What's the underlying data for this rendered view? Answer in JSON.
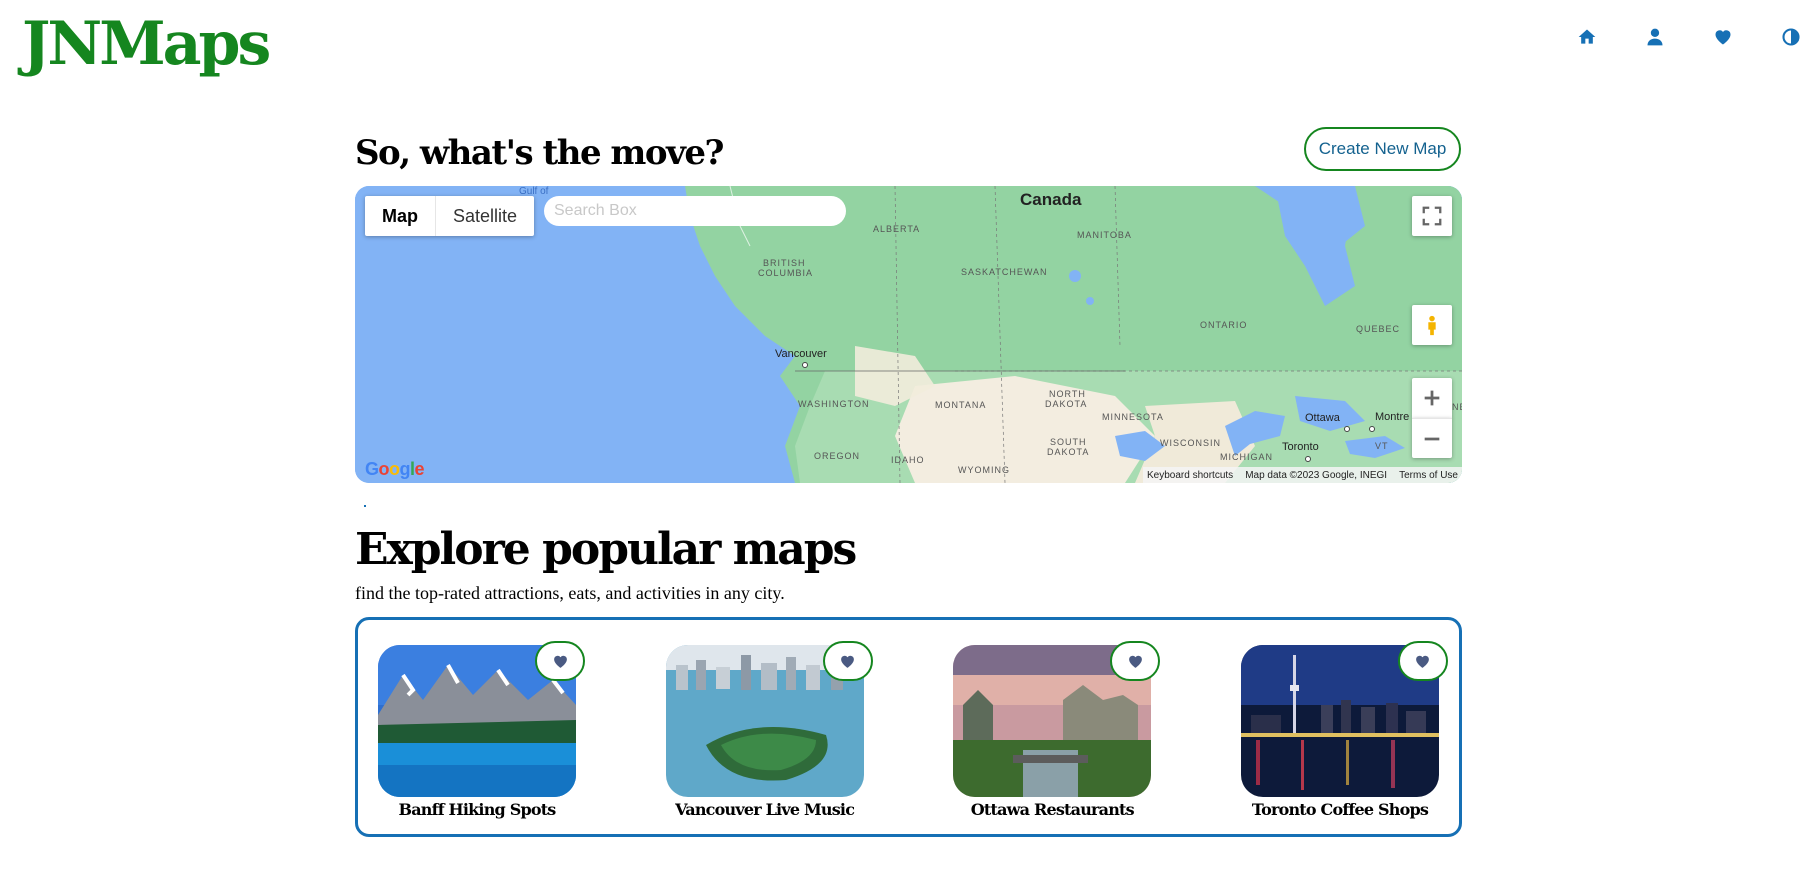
{
  "app": {
    "brand": "JNMaps"
  },
  "nav": {
    "icons": [
      "home-icon",
      "user-icon",
      "heart-icon",
      "contrast-icon"
    ]
  },
  "hero": {
    "headline": "So, what's the move?",
    "create_button": "Create New Map"
  },
  "map": {
    "type_options": [
      "Map",
      "Satellite"
    ],
    "active_type": "Map",
    "search_placeholder": "Search Box",
    "search_value": "",
    "regions": {
      "canada": "Canada",
      "alberta": "ALBERTA",
      "manitoba": "MANITOBA",
      "british_columbia_1": "BRITISH",
      "british_columbia_2": "COLUMBIA",
      "saskatchewan": "SASKATCHEWAN",
      "ontario": "ONTARIO",
      "quebec": "QUEBEC",
      "washington": "WASHINGTON",
      "montana": "MONTANA",
      "north_dakota_1": "NORTH",
      "north_dakota_2": "DAKOTA",
      "minnesota": "MINNESOTA",
      "south_dakota_1": "SOUTH",
      "south_dakota_2": "DAKOTA",
      "wisconsin": "WISCONSIN",
      "michigan": "MICHIGAN",
      "oregon": "OREGON",
      "idaho": "IDAHO",
      "wyoming": "WYOMING",
      "vt": "VT",
      "ne": "NE",
      "gulf": "Gulf of"
    },
    "cities": {
      "vancouver": "Vancouver",
      "ottawa": "Ottawa",
      "montreal": "Montre",
      "toronto": "Toronto"
    },
    "logo_letters": [
      "G",
      "o",
      "o",
      "g",
      "l",
      "e"
    ],
    "attribution": {
      "shortcuts": "Keyboard shortcuts",
      "data": "Map data ©2023 Google, INEGI",
      "terms": "Terms of Use"
    }
  },
  "explore": {
    "title": "Explore popular maps",
    "subtitle": "find the top-rated attractions, eats, and activities in any city.",
    "cards": [
      {
        "title": "Banff Hiking Spots"
      },
      {
        "title": "Vancouver Live Music"
      },
      {
        "title": "Ottawa Restaurants"
      },
      {
        "title": "Toronto Coffee Shops"
      }
    ]
  },
  "colors": {
    "brand_green": "#15861f",
    "accent_blue": "#1670b5",
    "water": "#82b3f5",
    "land": "#8fd19e",
    "heart": "#4a5a82"
  }
}
